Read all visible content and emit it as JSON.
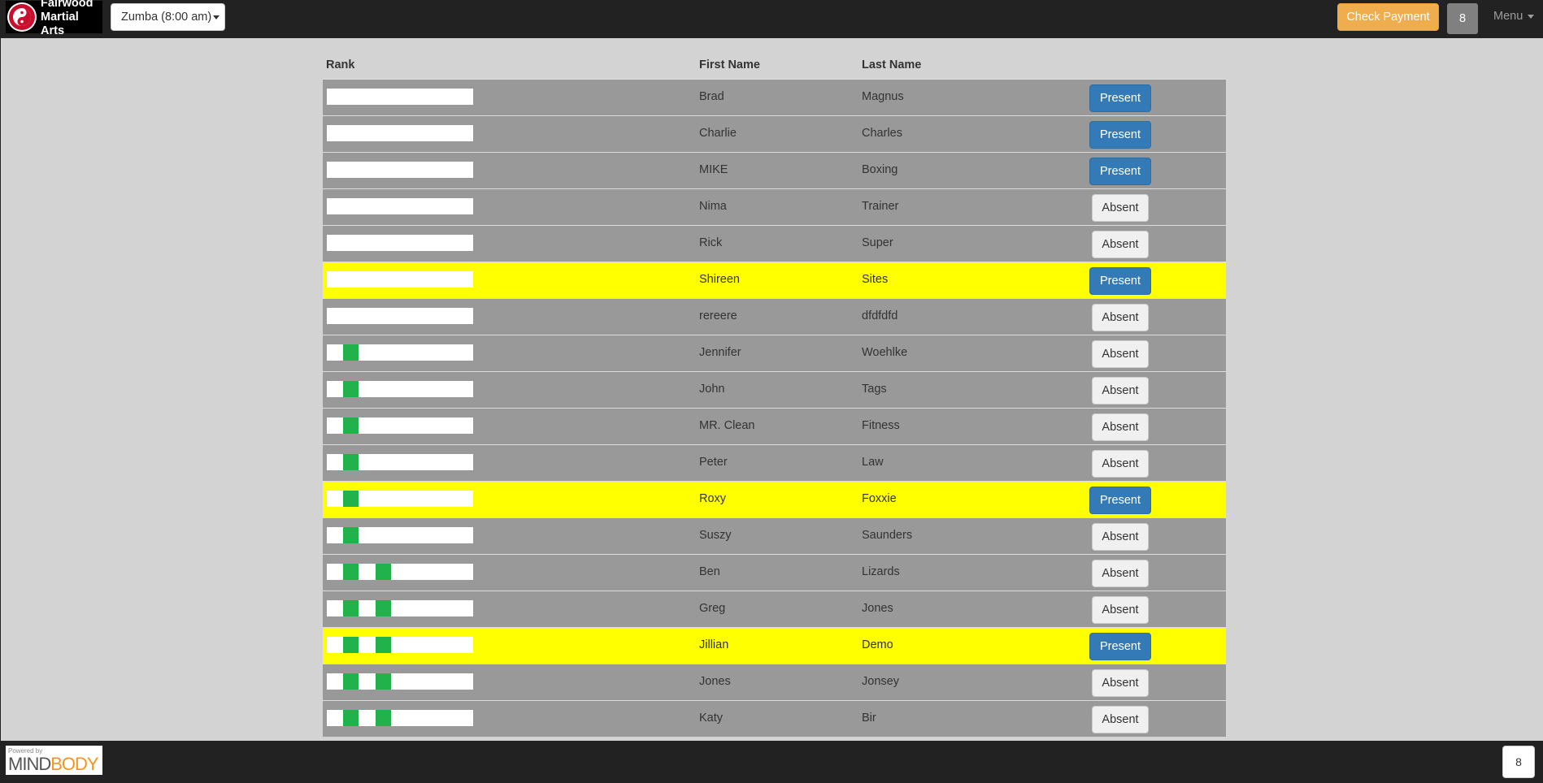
{
  "header": {
    "logo_text_line1": "Fairwood",
    "logo_text_line2": "Martial Arts",
    "class_select": "Zumba (8:00 am)",
    "check_payment": "Check Payment",
    "count": "8",
    "menu_label": "Menu"
  },
  "colors": {
    "topbar": "#222222",
    "check_payment": "#f0ad4e",
    "present": "#337ab7",
    "highlight_row": "#ffff00",
    "row": "#999999",
    "rank_stripe": "#22b24c"
  },
  "table": {
    "headers": {
      "rank": "Rank",
      "first": "First Name",
      "last": "Last Name"
    },
    "rows": [
      {
        "first": "Brad",
        "last": "Magnus",
        "status": "Present",
        "stripes": 0,
        "highlight": false
      },
      {
        "first": "Charlie",
        "last": "Charles",
        "status": "Present",
        "stripes": 0,
        "highlight": false
      },
      {
        "first": "MIKE",
        "last": "Boxing",
        "status": "Present",
        "stripes": 0,
        "highlight": false
      },
      {
        "first": "Nima",
        "last": "Trainer",
        "status": "Absent",
        "stripes": 0,
        "highlight": false
      },
      {
        "first": "Rick",
        "last": "Super",
        "status": "Absent",
        "stripes": 0,
        "highlight": false
      },
      {
        "first": "Shireen",
        "last": "Sites",
        "status": "Present",
        "stripes": 0,
        "highlight": true
      },
      {
        "first": "rereere",
        "last": "dfdfdfd",
        "status": "Absent",
        "stripes": 0,
        "highlight": false
      },
      {
        "first": "Jennifer",
        "last": "Woehlke",
        "status": "Absent",
        "stripes": 1,
        "highlight": false
      },
      {
        "first": "John",
        "last": "Tags",
        "status": "Absent",
        "stripes": 1,
        "highlight": false
      },
      {
        "first": "MR. Clean",
        "last": "Fitness",
        "status": "Absent",
        "stripes": 1,
        "highlight": false
      },
      {
        "first": "Peter",
        "last": "Law",
        "status": "Absent",
        "stripes": 1,
        "highlight": false
      },
      {
        "first": "Roxy",
        "last": "Foxxie",
        "status": "Present",
        "stripes": 1,
        "highlight": true
      },
      {
        "first": "Suszy",
        "last": "Saunders",
        "status": "Absent",
        "stripes": 1,
        "highlight": false
      },
      {
        "first": "Ben",
        "last": "Lizards",
        "status": "Absent",
        "stripes": 2,
        "highlight": false
      },
      {
        "first": "Greg",
        "last": "Jones",
        "status": "Absent",
        "stripes": 2,
        "highlight": false
      },
      {
        "first": "Jillian",
        "last": "Demo",
        "status": "Present",
        "stripes": 2,
        "highlight": true
      },
      {
        "first": "Jones",
        "last": "Jonsey",
        "status": "Absent",
        "stripes": 2,
        "highlight": false
      },
      {
        "first": "Katy",
        "last": "Bir",
        "status": "Absent",
        "stripes": 2,
        "highlight": false
      }
    ]
  },
  "footer": {
    "powered_by": "Powered by",
    "brand_mind": "MIND",
    "brand_body": "BODY",
    "count": "8"
  }
}
